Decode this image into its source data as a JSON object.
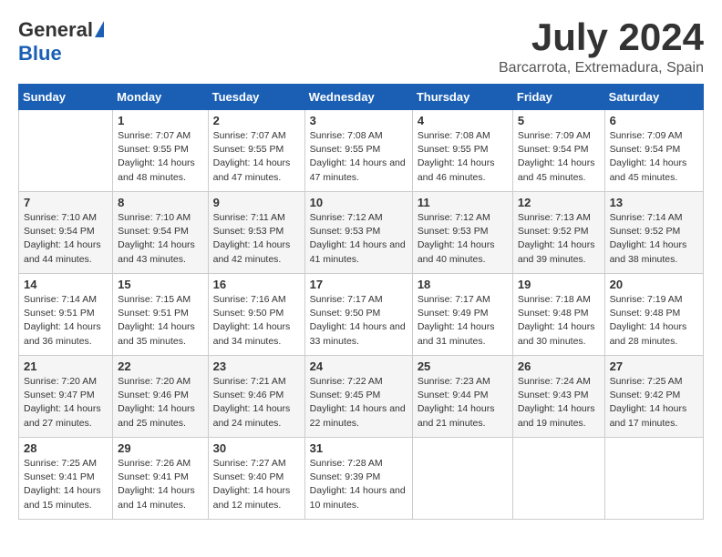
{
  "header": {
    "logo_general": "General",
    "logo_blue": "Blue",
    "month_title": "July 2024",
    "location": "Barcarrota, Extremadura, Spain"
  },
  "weekdays": [
    "Sunday",
    "Monday",
    "Tuesday",
    "Wednesday",
    "Thursday",
    "Friday",
    "Saturday"
  ],
  "weeks": [
    [
      {
        "day": "",
        "sunrise": "",
        "sunset": "",
        "daylight": ""
      },
      {
        "day": "1",
        "sunrise": "Sunrise: 7:07 AM",
        "sunset": "Sunset: 9:55 PM",
        "daylight": "Daylight: 14 hours and 48 minutes."
      },
      {
        "day": "2",
        "sunrise": "Sunrise: 7:07 AM",
        "sunset": "Sunset: 9:55 PM",
        "daylight": "Daylight: 14 hours and 47 minutes."
      },
      {
        "day": "3",
        "sunrise": "Sunrise: 7:08 AM",
        "sunset": "Sunset: 9:55 PM",
        "daylight": "Daylight: 14 hours and 47 minutes."
      },
      {
        "day": "4",
        "sunrise": "Sunrise: 7:08 AM",
        "sunset": "Sunset: 9:55 PM",
        "daylight": "Daylight: 14 hours and 46 minutes."
      },
      {
        "day": "5",
        "sunrise": "Sunrise: 7:09 AM",
        "sunset": "Sunset: 9:54 PM",
        "daylight": "Daylight: 14 hours and 45 minutes."
      },
      {
        "day": "6",
        "sunrise": "Sunrise: 7:09 AM",
        "sunset": "Sunset: 9:54 PM",
        "daylight": "Daylight: 14 hours and 45 minutes."
      }
    ],
    [
      {
        "day": "7",
        "sunrise": "Sunrise: 7:10 AM",
        "sunset": "Sunset: 9:54 PM",
        "daylight": "Daylight: 14 hours and 44 minutes."
      },
      {
        "day": "8",
        "sunrise": "Sunrise: 7:10 AM",
        "sunset": "Sunset: 9:54 PM",
        "daylight": "Daylight: 14 hours and 43 minutes."
      },
      {
        "day": "9",
        "sunrise": "Sunrise: 7:11 AM",
        "sunset": "Sunset: 9:53 PM",
        "daylight": "Daylight: 14 hours and 42 minutes."
      },
      {
        "day": "10",
        "sunrise": "Sunrise: 7:12 AM",
        "sunset": "Sunset: 9:53 PM",
        "daylight": "Daylight: 14 hours and 41 minutes."
      },
      {
        "day": "11",
        "sunrise": "Sunrise: 7:12 AM",
        "sunset": "Sunset: 9:53 PM",
        "daylight": "Daylight: 14 hours and 40 minutes."
      },
      {
        "day": "12",
        "sunrise": "Sunrise: 7:13 AM",
        "sunset": "Sunset: 9:52 PM",
        "daylight": "Daylight: 14 hours and 39 minutes."
      },
      {
        "day": "13",
        "sunrise": "Sunrise: 7:14 AM",
        "sunset": "Sunset: 9:52 PM",
        "daylight": "Daylight: 14 hours and 38 minutes."
      }
    ],
    [
      {
        "day": "14",
        "sunrise": "Sunrise: 7:14 AM",
        "sunset": "Sunset: 9:51 PM",
        "daylight": "Daylight: 14 hours and 36 minutes."
      },
      {
        "day": "15",
        "sunrise": "Sunrise: 7:15 AM",
        "sunset": "Sunset: 9:51 PM",
        "daylight": "Daylight: 14 hours and 35 minutes."
      },
      {
        "day": "16",
        "sunrise": "Sunrise: 7:16 AM",
        "sunset": "Sunset: 9:50 PM",
        "daylight": "Daylight: 14 hours and 34 minutes."
      },
      {
        "day": "17",
        "sunrise": "Sunrise: 7:17 AM",
        "sunset": "Sunset: 9:50 PM",
        "daylight": "Daylight: 14 hours and 33 minutes."
      },
      {
        "day": "18",
        "sunrise": "Sunrise: 7:17 AM",
        "sunset": "Sunset: 9:49 PM",
        "daylight": "Daylight: 14 hours and 31 minutes."
      },
      {
        "day": "19",
        "sunrise": "Sunrise: 7:18 AM",
        "sunset": "Sunset: 9:48 PM",
        "daylight": "Daylight: 14 hours and 30 minutes."
      },
      {
        "day": "20",
        "sunrise": "Sunrise: 7:19 AM",
        "sunset": "Sunset: 9:48 PM",
        "daylight": "Daylight: 14 hours and 28 minutes."
      }
    ],
    [
      {
        "day": "21",
        "sunrise": "Sunrise: 7:20 AM",
        "sunset": "Sunset: 9:47 PM",
        "daylight": "Daylight: 14 hours and 27 minutes."
      },
      {
        "day": "22",
        "sunrise": "Sunrise: 7:20 AM",
        "sunset": "Sunset: 9:46 PM",
        "daylight": "Daylight: 14 hours and 25 minutes."
      },
      {
        "day": "23",
        "sunrise": "Sunrise: 7:21 AM",
        "sunset": "Sunset: 9:46 PM",
        "daylight": "Daylight: 14 hours and 24 minutes."
      },
      {
        "day": "24",
        "sunrise": "Sunrise: 7:22 AM",
        "sunset": "Sunset: 9:45 PM",
        "daylight": "Daylight: 14 hours and 22 minutes."
      },
      {
        "day": "25",
        "sunrise": "Sunrise: 7:23 AM",
        "sunset": "Sunset: 9:44 PM",
        "daylight": "Daylight: 14 hours and 21 minutes."
      },
      {
        "day": "26",
        "sunrise": "Sunrise: 7:24 AM",
        "sunset": "Sunset: 9:43 PM",
        "daylight": "Daylight: 14 hours and 19 minutes."
      },
      {
        "day": "27",
        "sunrise": "Sunrise: 7:25 AM",
        "sunset": "Sunset: 9:42 PM",
        "daylight": "Daylight: 14 hours and 17 minutes."
      }
    ],
    [
      {
        "day": "28",
        "sunrise": "Sunrise: 7:25 AM",
        "sunset": "Sunset: 9:41 PM",
        "daylight": "Daylight: 14 hours and 15 minutes."
      },
      {
        "day": "29",
        "sunrise": "Sunrise: 7:26 AM",
        "sunset": "Sunset: 9:41 PM",
        "daylight": "Daylight: 14 hours and 14 minutes."
      },
      {
        "day": "30",
        "sunrise": "Sunrise: 7:27 AM",
        "sunset": "Sunset: 9:40 PM",
        "daylight": "Daylight: 14 hours and 12 minutes."
      },
      {
        "day": "31",
        "sunrise": "Sunrise: 7:28 AM",
        "sunset": "Sunset: 9:39 PM",
        "daylight": "Daylight: 14 hours and 10 minutes."
      },
      {
        "day": "",
        "sunrise": "",
        "sunset": "",
        "daylight": ""
      },
      {
        "day": "",
        "sunrise": "",
        "sunset": "",
        "daylight": ""
      },
      {
        "day": "",
        "sunrise": "",
        "sunset": "",
        "daylight": ""
      }
    ]
  ]
}
